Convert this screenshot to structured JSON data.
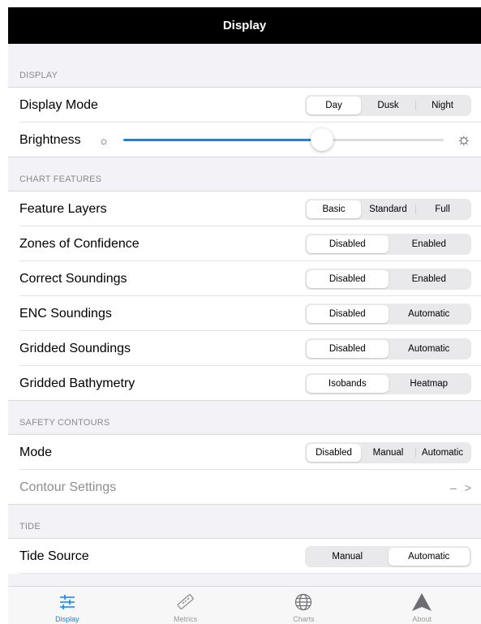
{
  "navbar": {
    "title": "Display"
  },
  "sections": {
    "display": {
      "header": "DISPLAY",
      "display_mode": {
        "label": "Display Mode",
        "options": [
          "Day",
          "Dusk",
          "Night"
        ],
        "selected": "Day"
      },
      "brightness": {
        "label": "Brightness",
        "value_fraction": 0.62
      }
    },
    "chart_features": {
      "header": "CHART FEATURES",
      "feature_layers": {
        "label": "Feature Layers",
        "options": [
          "Basic",
          "Standard",
          "Full"
        ],
        "selected": "Basic"
      },
      "zones_of_confidence": {
        "label": "Zones of Confidence",
        "options": [
          "Disabled",
          "Enabled"
        ],
        "selected": "Disabled"
      },
      "correct_soundings": {
        "label": "Correct Soundings",
        "options": [
          "Disabled",
          "Enabled"
        ],
        "selected": "Disabled"
      },
      "enc_soundings": {
        "label": "ENC Soundings",
        "options": [
          "Disabled",
          "Automatic"
        ],
        "selected": "Disabled"
      },
      "gridded_soundings": {
        "label": "Gridded Soundings",
        "options": [
          "Disabled",
          "Automatic"
        ],
        "selected": "Disabled"
      },
      "gridded_bathymetry": {
        "label": "Gridded Bathymetry",
        "options": [
          "Isobands",
          "Heatmap"
        ],
        "selected": "Isobands"
      }
    },
    "safety_contours": {
      "header": "SAFETY CONTOURS",
      "mode": {
        "label": "Mode",
        "options": [
          "Disabled",
          "Manual",
          "Automatic"
        ],
        "selected": "Disabled"
      },
      "contour_settings": {
        "label": "Contour Settings",
        "value": "–",
        "chevron": ">"
      }
    },
    "tide": {
      "header": "TIDE",
      "tide_source": {
        "label": "Tide Source",
        "options": [
          "Manual",
          "Automatic"
        ],
        "selected": "Automatic"
      }
    }
  },
  "tabbar": {
    "tabs": [
      {
        "label": "Display",
        "icon": "sliders-icon",
        "active": true
      },
      {
        "label": "Metrics",
        "icon": "ruler-icon",
        "active": false
      },
      {
        "label": "Charts",
        "icon": "globe-icon",
        "active": false
      },
      {
        "label": "About",
        "icon": "arrow-icon",
        "active": false
      }
    ]
  },
  "colors": {
    "accent": "#0a84ff",
    "navbar_bg": "#000000",
    "grouped_bg": "#f2f2f7"
  }
}
